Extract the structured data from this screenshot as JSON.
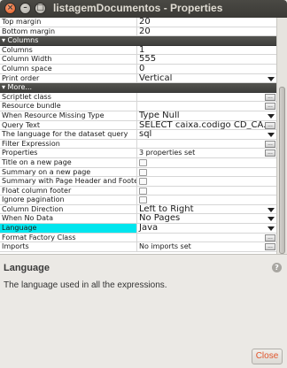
{
  "window": {
    "title": "listagemDocumentos - Properties"
  },
  "rows": [
    {
      "type": "text",
      "name": "Top margin",
      "value": "20"
    },
    {
      "type": "text",
      "name": "Bottom margin",
      "value": "20"
    },
    {
      "type": "section",
      "name": "▾ Columns"
    },
    {
      "type": "text",
      "name": "Columns",
      "value": "1"
    },
    {
      "type": "text",
      "name": "Column Width",
      "value": "555"
    },
    {
      "type": "text",
      "name": "Column space",
      "value": "0"
    },
    {
      "type": "combo",
      "name": "Print order",
      "value": "Vertical"
    },
    {
      "type": "section",
      "name": "▾ More..."
    },
    {
      "type": "dots",
      "name": "Scriptlet class",
      "value": ""
    },
    {
      "type": "dots",
      "name": "Resource bundle",
      "value": ""
    },
    {
      "type": "combo",
      "name": "When Resource Missing Type",
      "value": "Type Null"
    },
    {
      "type": "dotsbig",
      "name": "Query Text",
      "value": "SELECT caixa.codigo CD_CA..."
    },
    {
      "type": "combo",
      "name": "The language for the dataset query",
      "value": "sql"
    },
    {
      "type": "dots",
      "name": "Filter Expression",
      "value": ""
    },
    {
      "type": "dots",
      "name": "Properties",
      "value": "3 properties set"
    },
    {
      "type": "check",
      "name": "Title on a new page"
    },
    {
      "type": "check",
      "name": "Summary on a new page"
    },
    {
      "type": "check",
      "name": "Summary with Page Header and Footer"
    },
    {
      "type": "check",
      "name": "Float column footer"
    },
    {
      "type": "check",
      "name": "Ignore pagination"
    },
    {
      "type": "combo",
      "name": "Column Direction",
      "value": "Left to Right"
    },
    {
      "type": "combo",
      "name": "When No Data",
      "value": "No Pages"
    },
    {
      "type": "combo",
      "name": "Language",
      "value": "Java",
      "selected": true
    },
    {
      "type": "dots",
      "name": "Format Factory Class",
      "value": ""
    },
    {
      "type": "dots",
      "name": "Imports",
      "value": "No imports set"
    }
  ],
  "help": {
    "title": "Language",
    "text": "The language used in all the expressions.",
    "icon": "help-icon"
  },
  "buttons": {
    "close_label": "Close"
  },
  "colors": {
    "selection": "#00e5ee",
    "titlebar": "#3b3a36",
    "close_text": "#e2552b"
  }
}
